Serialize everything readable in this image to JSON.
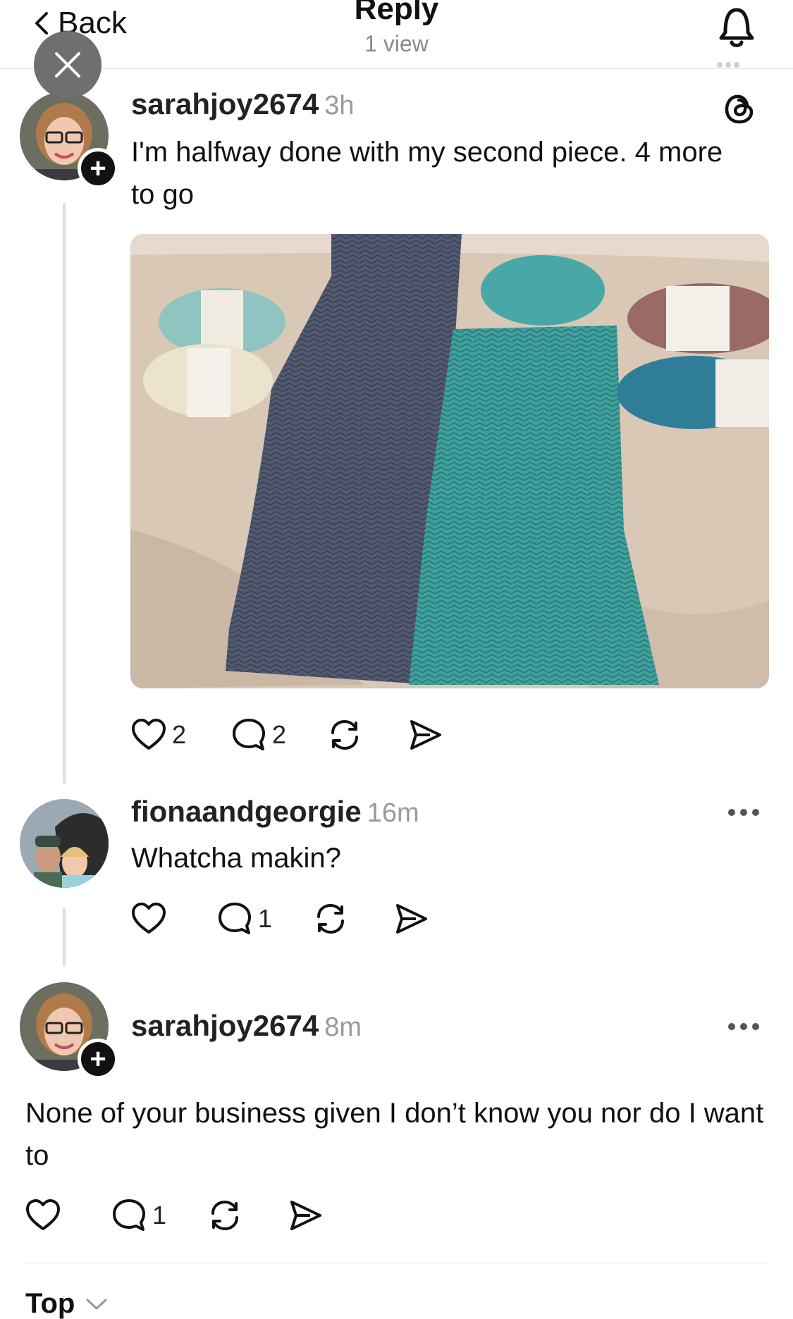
{
  "header": {
    "back_label": "Back",
    "title": "Reply",
    "subtitle": "1 view"
  },
  "posts": [
    {
      "username": "sarahjoy2674",
      "time": "3h",
      "text": "I'm halfway done with my second piece. 4 more to go",
      "likes": "2",
      "replies": "2"
    },
    {
      "username": "fionaandgeorgie",
      "time": "16m",
      "text": "Whatcha makin?",
      "likes": "",
      "replies": "1"
    },
    {
      "username": "sarahjoy2674",
      "time": "8m",
      "text": "None of your business given I don’t know you nor do I want to",
      "likes": "",
      "replies": "1"
    }
  ],
  "sort": {
    "label": "Top"
  },
  "icons": {
    "back": "chevron-left-icon",
    "close": "close-icon",
    "bell": "bell-icon",
    "threads": "threads-logo-icon",
    "like": "heart-icon",
    "reply": "comment-icon",
    "repost": "repost-icon",
    "share": "share-icon",
    "more": "more-dots-icon",
    "sort": "chevron-down-icon"
  },
  "colors": {
    "accent_text": "#111111",
    "muted_text": "#9a9a9a",
    "close_button": "#6f6f6f"
  }
}
